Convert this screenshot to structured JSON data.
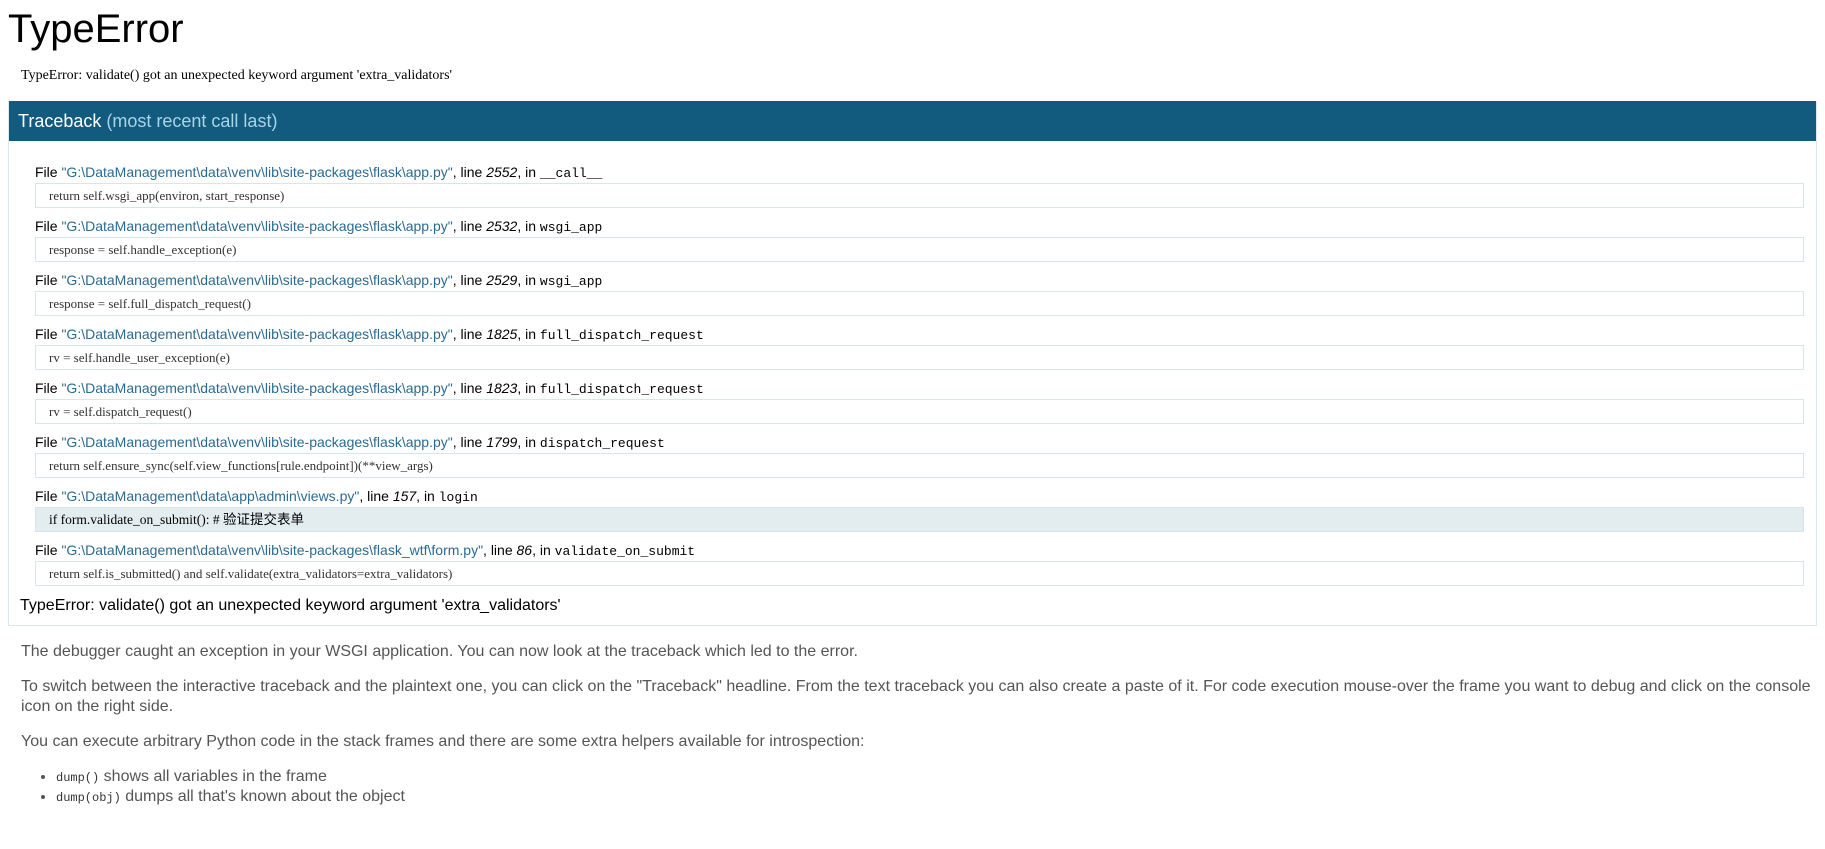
{
  "title": "TypeError",
  "error_message": "TypeError: validate() got an unexpected keyword argument 'extra_validators'",
  "traceback": {
    "header_label": "Traceback",
    "header_sub": "(most recent call last)",
    "frames": [
      {
        "file_prefix": "File ",
        "path": "\"G:\\DataManagement\\data\\venv\\lib\\site-packages\\flask\\app.py\"",
        "line_prefix": ", line ",
        "lineno": "2552",
        "in_prefix": ", in ",
        "func": "__call__",
        "source": "return self.wsgi_app(environ, start_response)"
      },
      {
        "file_prefix": "File ",
        "path": "\"G:\\DataManagement\\data\\venv\\lib\\site-packages\\flask\\app.py\"",
        "line_prefix": ", line ",
        "lineno": "2532",
        "in_prefix": ", in ",
        "func": "wsgi_app",
        "source": "response = self.handle_exception(e)"
      },
      {
        "file_prefix": "File ",
        "path": "\"G:\\DataManagement\\data\\venv\\lib\\site-packages\\flask\\app.py\"",
        "line_prefix": ", line ",
        "lineno": "2529",
        "in_prefix": ", in ",
        "func": "wsgi_app",
        "source": "response = self.full_dispatch_request()"
      },
      {
        "file_prefix": "File ",
        "path": "\"G:\\DataManagement\\data\\venv\\lib\\site-packages\\flask\\app.py\"",
        "line_prefix": ", line ",
        "lineno": "1825",
        "in_prefix": ", in ",
        "func": "full_dispatch_request",
        "source": "rv = self.handle_user_exception(e)"
      },
      {
        "file_prefix": "File ",
        "path": "\"G:\\DataManagement\\data\\venv\\lib\\site-packages\\flask\\app.py\"",
        "line_prefix": ", line ",
        "lineno": "1823",
        "in_prefix": ", in ",
        "func": "full_dispatch_request",
        "source": "rv = self.dispatch_request()"
      },
      {
        "file_prefix": "File ",
        "path": "\"G:\\DataManagement\\data\\venv\\lib\\site-packages\\flask\\app.py\"",
        "line_prefix": ", line ",
        "lineno": "1799",
        "in_prefix": ", in ",
        "func": "dispatch_request",
        "source": "return self.ensure_sync(self.view_functions[rule.endpoint])(**view_args)"
      },
      {
        "file_prefix": "File ",
        "path": "\"G:\\DataManagement\\data\\app\\admin\\views.py\"",
        "line_prefix": ", line ",
        "lineno": "157",
        "in_prefix": ", in ",
        "func": "login",
        "source": "if form.validate_on_submit():   # 验证提交表单",
        "current": true
      },
      {
        "file_prefix": "File ",
        "path": "\"G:\\DataManagement\\data\\venv\\lib\\site-packages\\flask_wtf\\form.py\"",
        "line_prefix": ", line ",
        "lineno": "86",
        "in_prefix": ", in ",
        "func": "validate_on_submit",
        "source": "return self.is_submitted() and self.validate(extra_validators=extra_validators)"
      }
    ],
    "final_error": "TypeError: validate() got an unexpected keyword argument 'extra_validators'"
  },
  "explanation": {
    "p1": "The debugger caught an exception in your WSGI application. You can now look at the traceback which led to the error.",
    "p2": "To switch between the interactive traceback and the plaintext one, you can click on the \"Traceback\" headline. From the text traceback you can also create a paste of it. For code execution mouse-over the frame you want to debug and click on the console icon on the right side.",
    "p3": "You can execute arbitrary Python code in the stack frames and there are some extra helpers available for introspection:",
    "helpers": [
      {
        "code": "dump()",
        "text": " shows all variables in the frame"
      },
      {
        "code": "dump(obj)",
        "text": " dumps all that's known about the object"
      }
    ]
  }
}
